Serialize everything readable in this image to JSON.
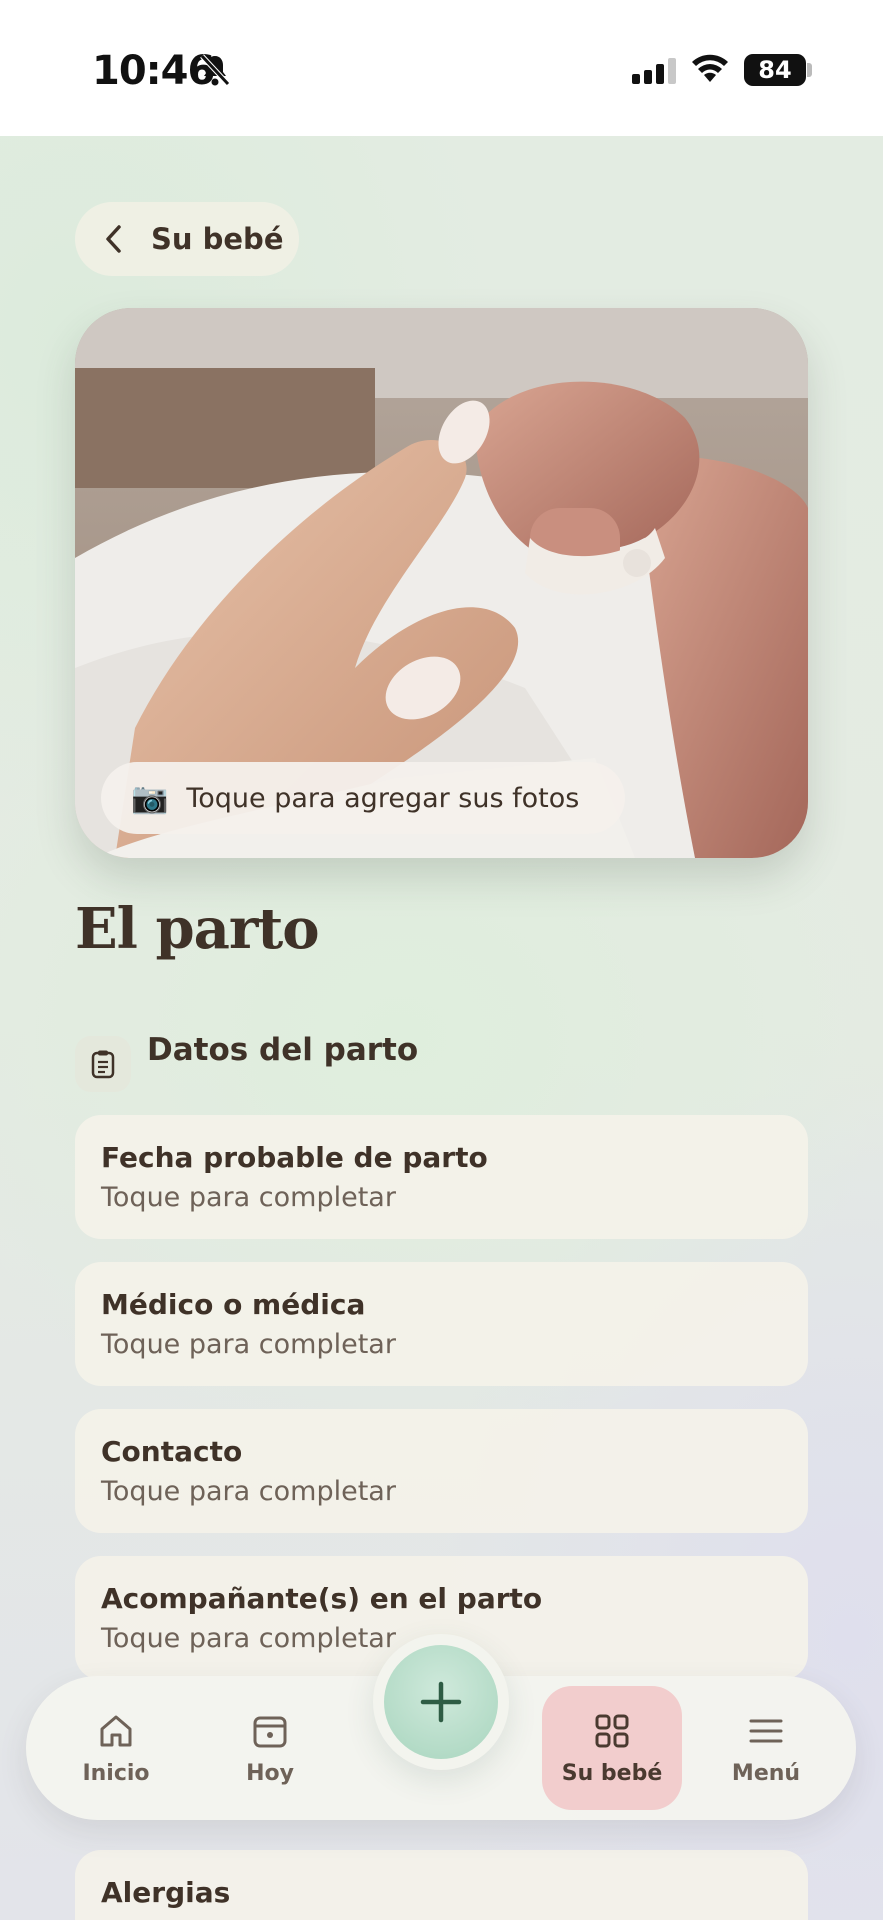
{
  "status_bar": {
    "time": "10:46",
    "battery": "84"
  },
  "header": {
    "back_label": "Su bebé"
  },
  "photo": {
    "add_photos_label": "Toque para agregar sus fotos"
  },
  "page": {
    "title": "El parto",
    "section_title": "Datos del parto",
    "fields": [
      {
        "label": "Fecha probable de parto",
        "hint": "Toque para completar"
      },
      {
        "label": "Médico o médica",
        "hint": "Toque para completar"
      },
      {
        "label": "Contacto",
        "hint": "Toque para completar"
      },
      {
        "label": "Acompañante(s) en el parto",
        "hint": "Toque para completar"
      },
      {
        "label": "Alergias"
      }
    ]
  },
  "nav": {
    "items": [
      {
        "label": "Inicio",
        "icon": "home-icon"
      },
      {
        "label": "Hoy",
        "icon": "calendar-icon"
      },
      {
        "label": "Su bebé",
        "icon": "grid-icon",
        "active": true
      },
      {
        "label": "Menú",
        "icon": "menu-icon"
      }
    ],
    "fab_icon": "plus-icon"
  },
  "colors": {
    "text": "#3f3228",
    "card": "#f4f2e9",
    "active_nav": "#f2cdcd",
    "fab": "#a8d5be"
  }
}
